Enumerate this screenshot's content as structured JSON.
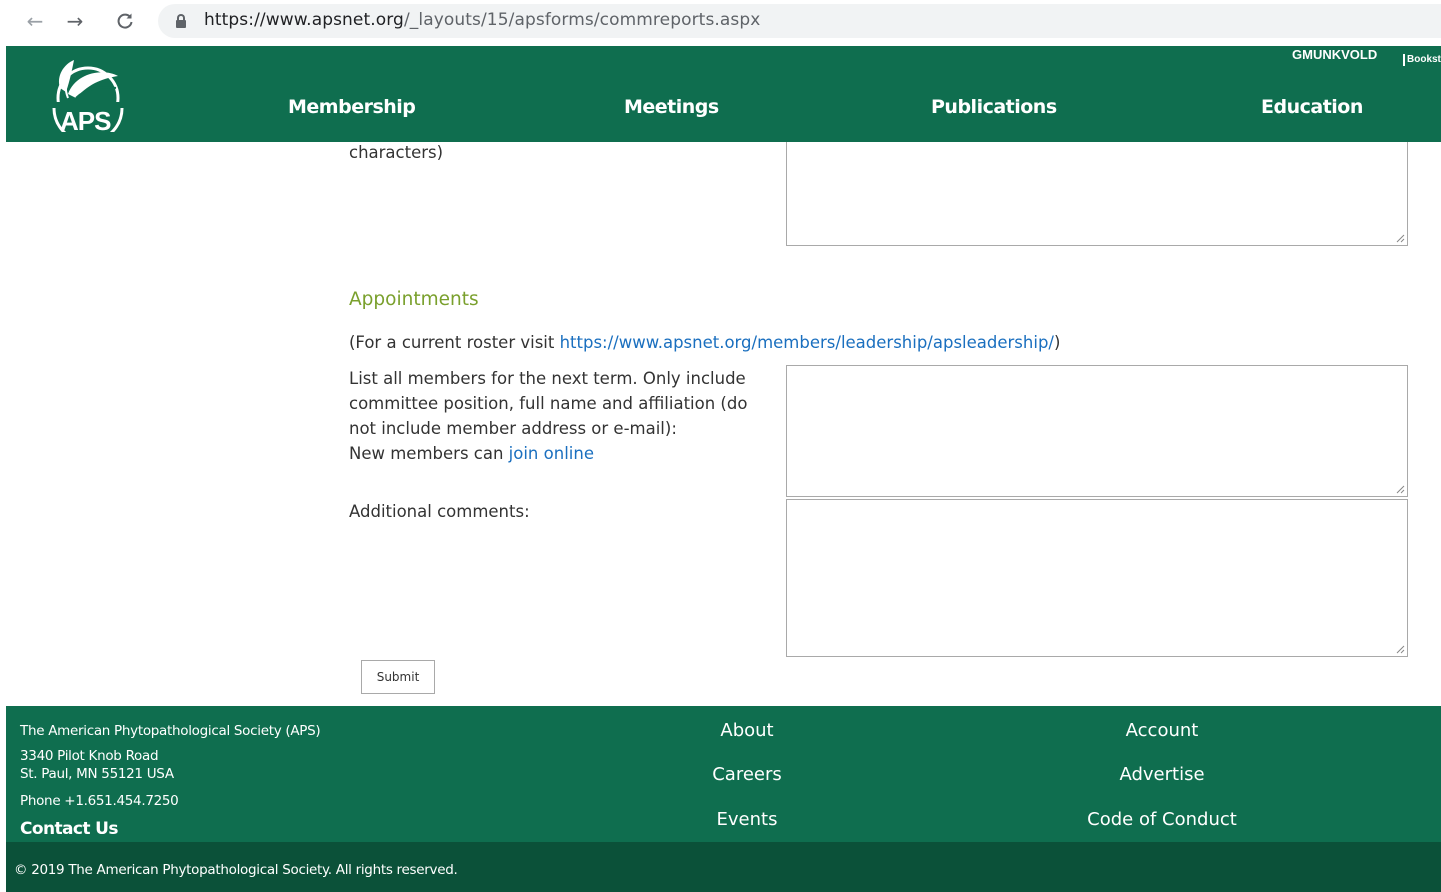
{
  "browser": {
    "url_host": "https://www.apsnet.org",
    "url_path": "/_layouts/15/apsforms/commreports.aspx"
  },
  "header": {
    "logo_text": "APS",
    "nav": [
      "Membership",
      "Meetings",
      "Publications",
      "Education"
    ],
    "user_name": "GMUNKVOLD",
    "bookstore_label": "Bookst"
  },
  "form": {
    "prev_label_tail": "characters)",
    "appointments_title": "Appointments",
    "roster_prefix": "(For a current roster visit ",
    "roster_link": "https://www.apsnet.org/members/leadership/apsleadership/",
    "roster_suffix": ")",
    "members_label": "List all members for the next term. Only include committee position, full name and affiliation (do not include member address or e-mail):",
    "new_members_prefix": "New members can ",
    "join_link": "join online",
    "additional_label": "Additional comments:",
    "submit_label": "Submit"
  },
  "footer": {
    "org_name": "The American Phytopathological Society (APS)",
    "address_line1": "3340 Pilot Knob Road",
    "address_line2": "St. Paul, MN 55121 USA",
    "phone": "Phone +1.651.454.7250",
    "contact": "Contact Us",
    "col1": [
      "About",
      "Careers",
      "Events"
    ],
    "col2": [
      "Account",
      "Advertise",
      "Code of Conduct"
    ],
    "copyright": "© 2019 The American Phytopathological Society. All rights reserved."
  },
  "colors": {
    "brand_green": "#0f6e4f",
    "copyright_green": "#0b5139",
    "section_title": "#7aa02d",
    "link": "#1a6fbf"
  }
}
